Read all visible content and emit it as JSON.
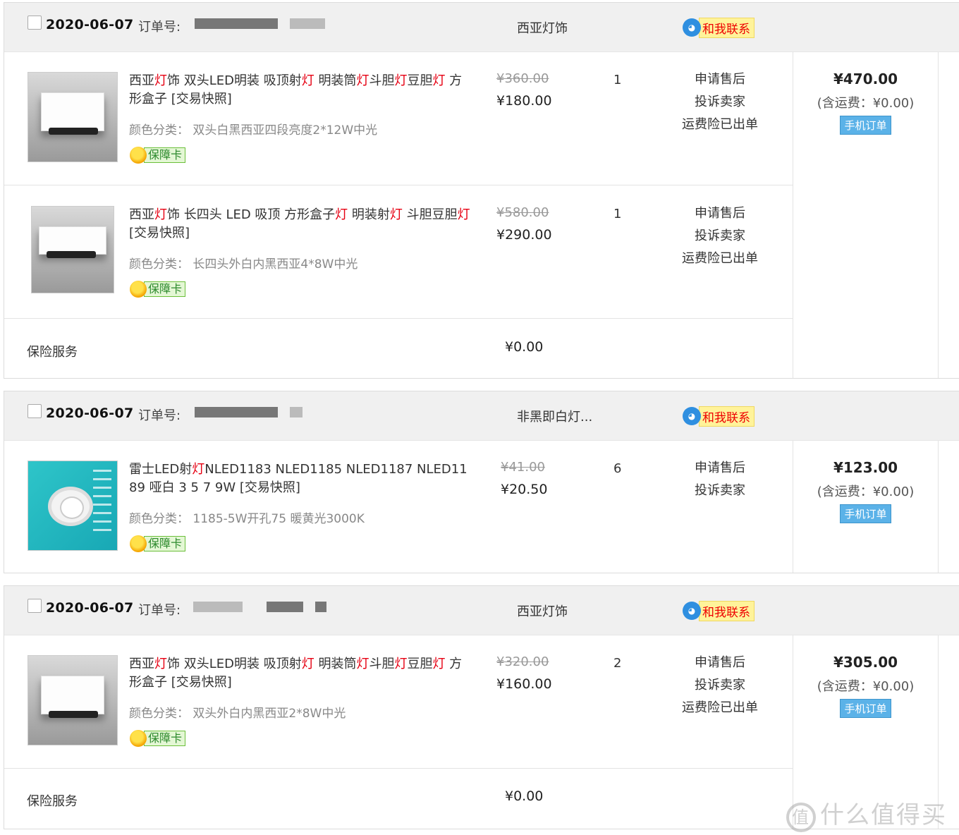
{
  "orders": [
    {
      "date": "2020-06-07",
      "order_label": "订单号:",
      "shop": "西亚灯饰",
      "contact_label": "和我联系",
      "items": [
        {
          "title_parts": [
            "西亚",
            "灯",
            "饰 双头LED明装 吸顶射",
            "灯",
            " 明装筒",
            "灯",
            "斗胆",
            "灯",
            "豆胆",
            "灯",
            " 方形盒子 [交易快照]"
          ],
          "spec": "颜色分类：  双头白黑西亚四段亮度2*12W中光",
          "badge": "保障卡",
          "old_price": "¥360.00",
          "price": "¥180.00",
          "qty": "1",
          "ops": [
            "申请售后",
            "投诉卖家",
            "运费险已出单"
          ]
        },
        {
          "title_parts": [
            "西亚",
            "灯",
            "饰 长四头 LED 吸顶 方形盒子",
            "灯",
            " 明装射",
            "灯",
            " 斗胆豆胆",
            "灯",
            " [交易快照]"
          ],
          "spec": "颜色分类：  长四头外白内黑西亚4*8W中光",
          "badge": "保障卡",
          "old_price": "¥580.00",
          "price": "¥290.00",
          "qty": "1",
          "ops": [
            "申请售后",
            "投诉卖家",
            "运费险已出单"
          ]
        }
      ],
      "insurance_label": "保险服务",
      "insurance_price": "¥0.00",
      "total": "¥470.00",
      "shipping": "(含运费：¥0.00)",
      "mobile_label": "手机订单"
    },
    {
      "date": "2020-06-07",
      "order_label": "订单号:",
      "shop": "非黑即白灯...",
      "contact_label": "和我联系",
      "items": [
        {
          "title_parts": [
            "雷士LED射",
            "灯",
            "NLED1183 NLED1185 NLED1187 NLED1189 哑白 3 5 7 9W [交易快照]"
          ],
          "spec": "颜色分类：  1185-5W开孔75 暖黄光3000K",
          "badge": "保障卡",
          "old_price": "¥41.00",
          "price": "¥20.50",
          "qty": "6",
          "ops": [
            "申请售后",
            "投诉卖家"
          ]
        }
      ],
      "total": "¥123.00",
      "shipping": "(含运费：¥0.00)",
      "mobile_label": "手机订单"
    },
    {
      "date": "2020-06-07",
      "order_label": "订单号:",
      "shop": "西亚灯饰",
      "contact_label": "和我联系",
      "items": [
        {
          "title_parts": [
            "西亚",
            "灯",
            "饰 双头LED明装 吸顶射",
            "灯",
            " 明装筒",
            "灯",
            "斗胆",
            "灯",
            "豆胆",
            "灯",
            " 方形盒子 [交易快照]"
          ],
          "spec": "颜色分类：  双头外白内黑西亚2*8W中光",
          "badge": "保障卡",
          "old_price": "¥320.00",
          "price": "¥160.00",
          "qty": "2",
          "ops": [
            "申请售后",
            "投诉卖家",
            "运费险已出单"
          ]
        }
      ],
      "insurance_label": "保险服务",
      "insurance_price": "¥0.00",
      "total": "¥305.00",
      "shipping": "(含运费：¥0.00)",
      "mobile_label": "手机订单"
    }
  ],
  "watermark": "什么值得买",
  "watermark_logo": "值",
  "colors": {
    "highlight": "#e60012",
    "header_bg": "#f0f0f0",
    "mobile_btn": "#5bb2e8",
    "contact_bg": "#fff39a"
  },
  "icons": {
    "contact": "qq-bubble-icon",
    "badge": "shield-icon"
  }
}
